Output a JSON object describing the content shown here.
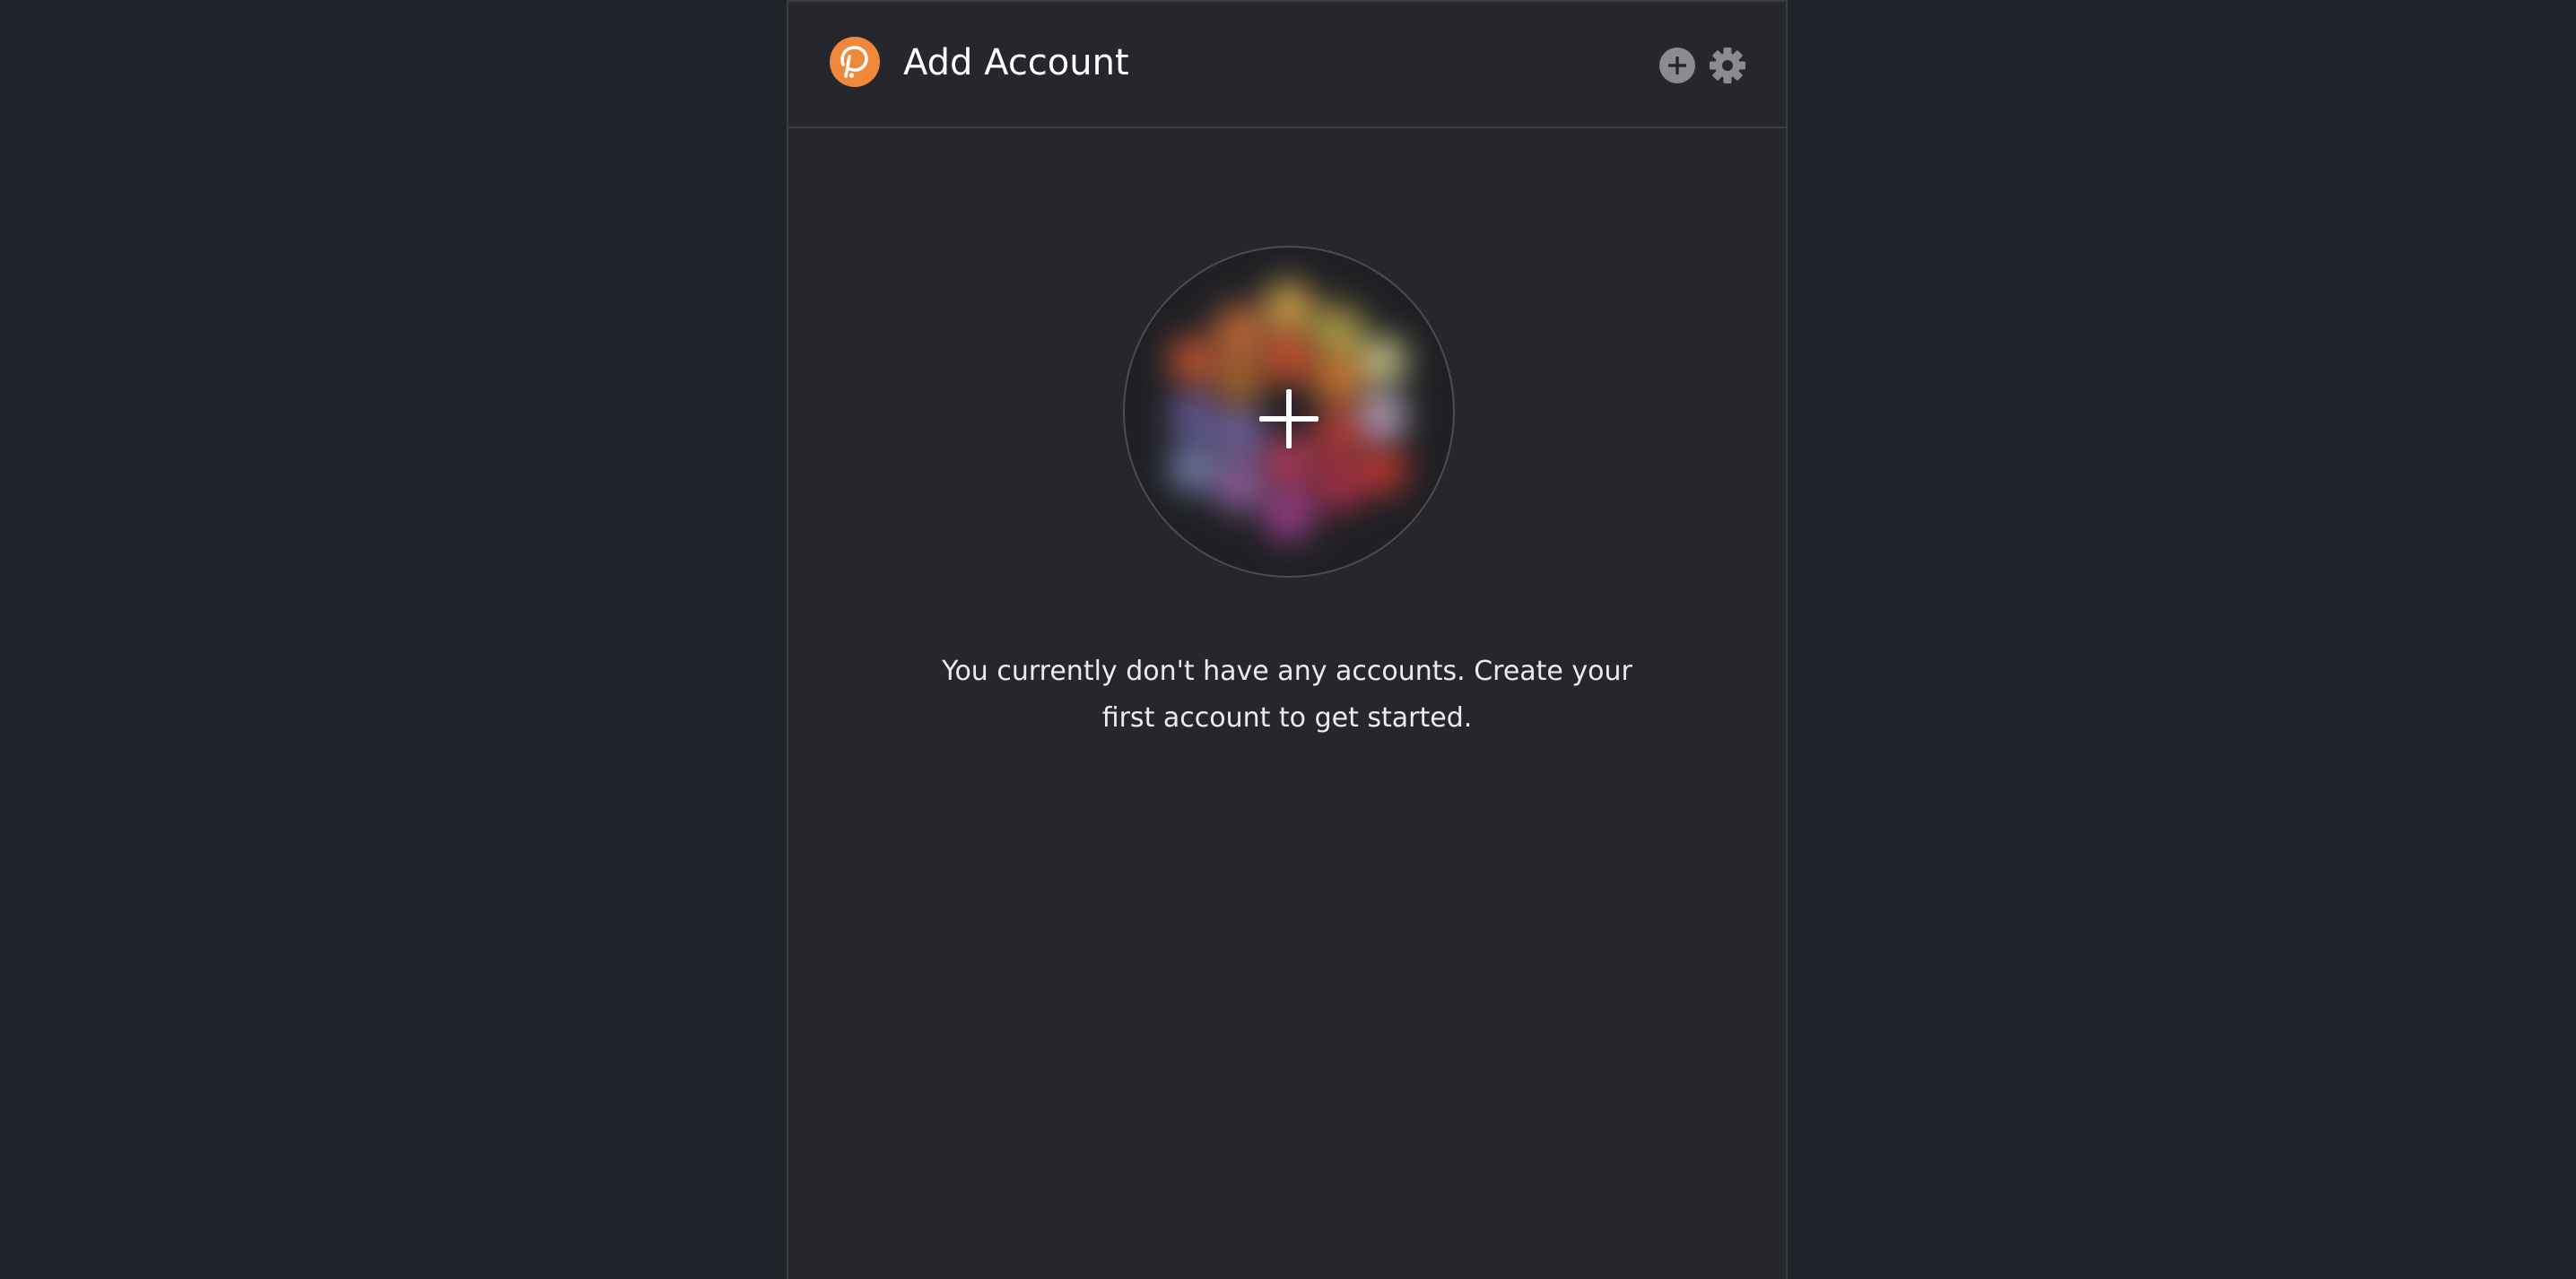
{
  "header": {
    "title": "Add Account",
    "logo_icon": "polkadot-logo-icon",
    "actions": [
      {
        "name": "add-account-icon",
        "icon": "plus-circle"
      },
      {
        "name": "settings-icon",
        "icon": "gear"
      }
    ]
  },
  "main": {
    "identicon_action_icon": "plus-icon",
    "empty_message": "You currently don't have any accounts. Create your first account to get started."
  },
  "colors": {
    "page_background": "#20232a",
    "panel_background": "#26272c",
    "brand_orange": "#f0883a",
    "icon_gray": "#8a8b8f",
    "text": "#ececec"
  }
}
